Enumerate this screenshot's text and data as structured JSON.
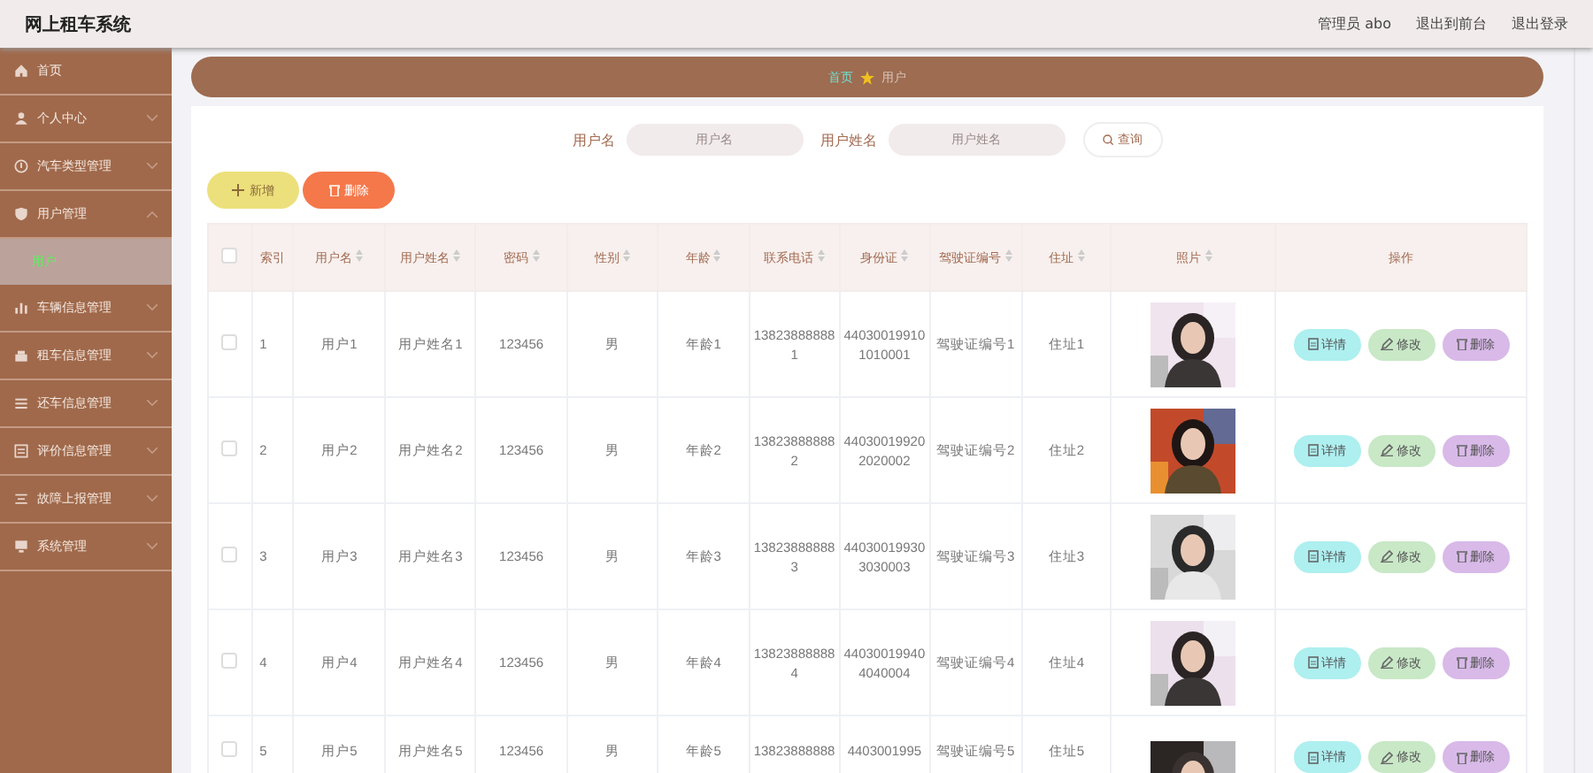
{
  "header": {
    "title": "网上租车系统",
    "links": [
      "管理员 abo",
      "退出到前台",
      "退出登录"
    ]
  },
  "sidebar": {
    "items": [
      {
        "label": "首页"
      },
      {
        "label": "个人中心",
        "expanded": false
      },
      {
        "label": "汽车类型管理",
        "expanded": false
      },
      {
        "label": "用户管理",
        "expanded": true,
        "children": [
          {
            "label": "用户",
            "selected": true
          }
        ]
      },
      {
        "label": "车辆信息管理",
        "expanded": false
      },
      {
        "label": "租车信息管理",
        "expanded": false
      },
      {
        "label": "还车信息管理",
        "expanded": false
      },
      {
        "label": "评价信息管理",
        "expanded": false
      },
      {
        "label": "故障上报管理",
        "expanded": false
      },
      {
        "label": "系统管理",
        "expanded": false
      }
    ]
  },
  "breadcrumb": [
    "首页",
    "用户"
  ],
  "search": {
    "fields": [
      {
        "label": "用户名",
        "placeholder": "用户名"
      },
      {
        "label": "用户姓名",
        "placeholder": "用户姓名"
      }
    ],
    "button": "查询"
  },
  "actions": [
    {
      "label": "新增",
      "kind": "add"
    },
    {
      "label": "删除",
      "kind": "delete"
    }
  ],
  "table": {
    "select_all": {
      "checked": false
    },
    "columns": [
      {
        "label": "索引",
        "sortable": false
      },
      {
        "label": "用户名",
        "sortable": true
      },
      {
        "label": "用户姓名",
        "sortable": true
      },
      {
        "label": "密码",
        "sortable": true
      },
      {
        "label": "性别",
        "sortable": true
      },
      {
        "label": "年龄",
        "sortable": true
      },
      {
        "label": "联系电话",
        "sortable": true
      },
      {
        "label": "身份证",
        "sortable": true
      },
      {
        "label": "驾驶证编号",
        "sortable": true
      },
      {
        "label": "住址",
        "sortable": true
      },
      {
        "label": "照片",
        "sortable": true
      },
      {
        "label": "操作",
        "sortable": false
      }
    ],
    "rows": [
      {
        "checked": false,
        "cells": [
          "1",
          "用户1",
          "用户姓名1",
          "123456",
          "男",
          "年龄1",
          "138238888881",
          "440300199101010001",
          "驾驶证编号1",
          "住址1"
        ],
        "buttons": [
          {
            "label": "详情",
            "kind": "detail"
          },
          {
            "label": "修改",
            "kind": "edit"
          },
          {
            "label": "删除",
            "kind": "delete"
          }
        ]
      },
      {
        "checked": false,
        "cells": [
          "2",
          "用户2",
          "用户姓名2",
          "123456",
          "男",
          "年龄2",
          "138238888882",
          "440300199202020002",
          "驾驶证编号2",
          "住址2"
        ],
        "buttons": [
          {
            "label": "详情",
            "kind": "detail"
          },
          {
            "label": "修改",
            "kind": "edit"
          },
          {
            "label": "删除",
            "kind": "delete"
          }
        ]
      },
      {
        "checked": false,
        "cells": [
          "3",
          "用户3",
          "用户姓名3",
          "123456",
          "男",
          "年龄3",
          "138238888883",
          "440300199303030003",
          "驾驶证编号3",
          "住址3"
        ],
        "buttons": [
          {
            "label": "详情",
            "kind": "detail"
          },
          {
            "label": "修改",
            "kind": "edit"
          },
          {
            "label": "删除",
            "kind": "delete"
          }
        ]
      },
      {
        "checked": false,
        "cells": [
          "4",
          "用户4",
          "用户姓名4",
          "123456",
          "男",
          "年龄4",
          "138238888884",
          "440300199404040004",
          "驾驶证编号4",
          "住址4"
        ],
        "buttons": [
          {
            "label": "详情",
            "kind": "detail"
          },
          {
            "label": "修改",
            "kind": "edit"
          },
          {
            "label": "删除",
            "kind": "delete"
          }
        ]
      },
      {
        "checked": false,
        "cells": [
          "5",
          "用户5",
          "用户姓名5",
          "123456",
          "男",
          "年龄5",
          "13823888888",
          "4403001995",
          "驾驶证编号5",
          "住址5"
        ],
        "buttons": [
          {
            "label": "详情",
            "kind": "detail"
          },
          {
            "label": "修改",
            "kind": "edit"
          },
          {
            "label": "删除",
            "kind": "delete"
          }
        ]
      }
    ]
  }
}
